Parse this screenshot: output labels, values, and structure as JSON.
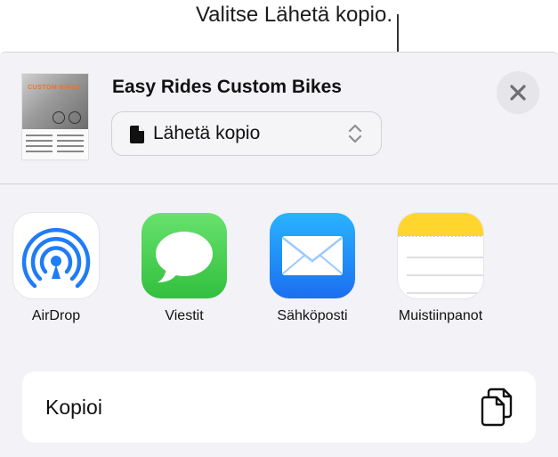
{
  "callout": {
    "text": "Valitse Lähetä kopio."
  },
  "document": {
    "title": "Easy Rides Custom Bikes",
    "thumbnail_text": "CUSTOM BIKES"
  },
  "send_option": {
    "label": "Lähetä kopio",
    "icon": "document-icon"
  },
  "close": {
    "icon": "close-icon"
  },
  "apps": [
    {
      "label": "AirDrop",
      "icon": "airdrop-icon"
    },
    {
      "label": "Viestit",
      "icon": "messages-icon"
    },
    {
      "label": "Sähköposti",
      "icon": "mail-icon"
    },
    {
      "label": "Muistiinpanot",
      "icon": "notes-icon"
    }
  ],
  "actions": [
    {
      "label": "Kopioi",
      "icon": "copy-icon"
    }
  ],
  "colors": {
    "airdrop": "#1f7cf5",
    "messages": "#34c759",
    "mail": "#1b6ff0",
    "notes_yellow": "#ffd52e",
    "sheet_bg": "#f2f2f7"
  }
}
